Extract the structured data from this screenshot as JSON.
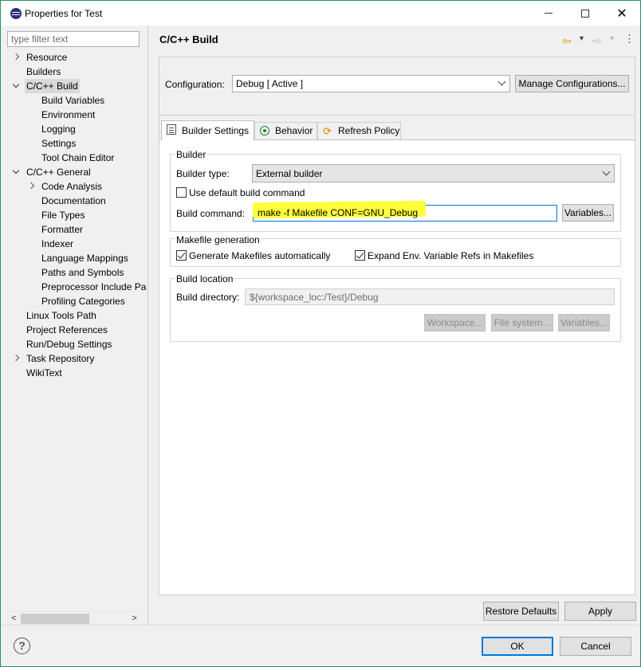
{
  "window": {
    "title": "Properties for Test"
  },
  "filter": {
    "placeholder": "type filter text"
  },
  "tree": [
    {
      "label": "Resource",
      "level": 0,
      "twisty": "closed"
    },
    {
      "label": "Builders",
      "level": 0,
      "twisty": "none"
    },
    {
      "label": "C/C++ Build",
      "level": 0,
      "twisty": "open",
      "selected": true
    },
    {
      "label": "Build Variables",
      "level": 1,
      "twisty": "none"
    },
    {
      "label": "Environment",
      "level": 1,
      "twisty": "none"
    },
    {
      "label": "Logging",
      "level": 1,
      "twisty": "none"
    },
    {
      "label": "Settings",
      "level": 1,
      "twisty": "none"
    },
    {
      "label": "Tool Chain Editor",
      "level": 1,
      "twisty": "none"
    },
    {
      "label": "C/C++ General",
      "level": 0,
      "twisty": "open"
    },
    {
      "label": "Code Analysis",
      "level": 1,
      "twisty": "closed"
    },
    {
      "label": "Documentation",
      "level": 1,
      "twisty": "none"
    },
    {
      "label": "File Types",
      "level": 1,
      "twisty": "none"
    },
    {
      "label": "Formatter",
      "level": 1,
      "twisty": "none"
    },
    {
      "label": "Indexer",
      "level": 1,
      "twisty": "none"
    },
    {
      "label": "Language Mappings",
      "level": 1,
      "twisty": "none"
    },
    {
      "label": "Paths and Symbols",
      "level": 1,
      "twisty": "none"
    },
    {
      "label": "Preprocessor Include Pa",
      "level": 1,
      "twisty": "none"
    },
    {
      "label": "Profiling Categories",
      "level": 1,
      "twisty": "none"
    },
    {
      "label": "Linux Tools Path",
      "level": 0,
      "twisty": "none"
    },
    {
      "label": "Project References",
      "level": 0,
      "twisty": "none"
    },
    {
      "label": "Run/Debug Settings",
      "level": 0,
      "twisty": "none"
    },
    {
      "label": "Task Repository",
      "level": 0,
      "twisty": "closed"
    },
    {
      "label": "WikiText",
      "level": 0,
      "twisty": "none"
    }
  ],
  "page": {
    "title": "C/C++ Build"
  },
  "config": {
    "label": "Configuration:",
    "value": "Debug  [ Active ]",
    "manage_button": "Manage Configurations..."
  },
  "tabs": [
    {
      "label": "Builder Settings",
      "icon": "document-icon",
      "active": true
    },
    {
      "label": "Behavior",
      "icon": "radio-icon",
      "active": false
    },
    {
      "label": "Refresh Policy",
      "icon": "refresh-icon",
      "active": false
    }
  ],
  "builder": {
    "group_title": "Builder",
    "type_label": "Builder type:",
    "type_value": "External builder",
    "use_default_label": "Use default build command",
    "use_default_checked": false,
    "command_label": "Build command:",
    "command_value": "make -f Makefile CONF=GNU_Debug",
    "variables_button": "Variables..."
  },
  "makefile": {
    "group_title": "Makefile generation",
    "generate_label": "Generate Makefiles automatically",
    "generate_checked": true,
    "expand_label": "Expand Env. Variable Refs in Makefiles",
    "expand_checked": true
  },
  "location": {
    "group_title": "Build location",
    "dir_label": "Build directory:",
    "dir_value": "${workspace_loc:/Test}/Debug",
    "workspace_button": "Workspace...",
    "filesystem_button": "File system...",
    "variables_button": "Variables..."
  },
  "footer": {
    "restore_button": "Restore Defaults",
    "apply_button": "Apply",
    "ok_button": "OK",
    "cancel_button": "Cancel"
  },
  "colors": {
    "highlight": "#ffff3c",
    "focus_border": "#0078d7",
    "window_border": "#2a8f5c"
  }
}
